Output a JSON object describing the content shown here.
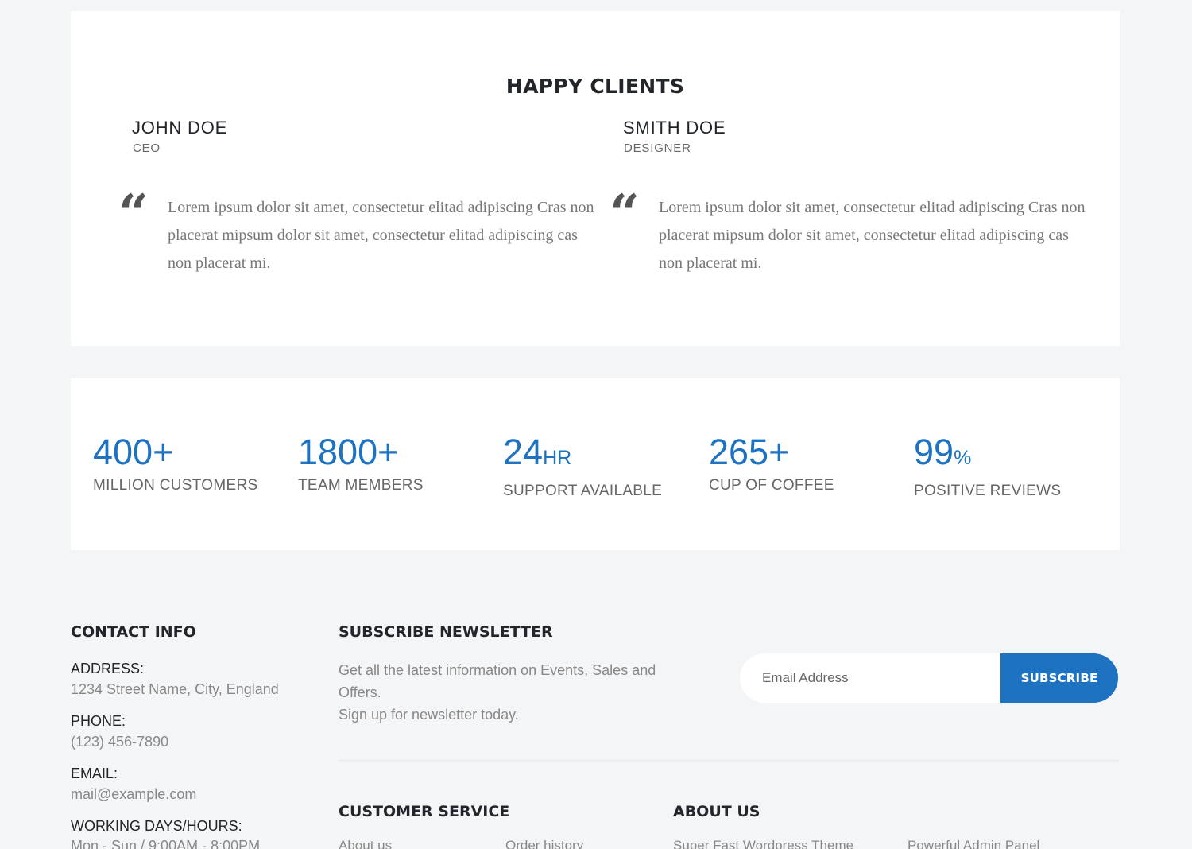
{
  "testimonials": {
    "title": "HAPPY CLIENTS",
    "items": [
      {
        "name": "JOHN DOE",
        "role": "CEO",
        "quote": "Lorem ipsum dolor sit amet, consectetur elitad adipiscing Cras non placerat mipsum dolor sit amet, consectetur elitad adipiscing cas non placerat mi."
      },
      {
        "name": "SMITH DOE",
        "role": "DESIGNER",
        "quote": "Lorem ipsum dolor sit amet, consectetur elitad adipiscing Cras non placerat mipsum dolor sit amet, consectetur elitad adipiscing cas non placerat mi."
      }
    ],
    "quote_glyph": "“"
  },
  "counters": [
    {
      "value": "400",
      "unit": "+",
      "label": "MILLION CUSTOMERS"
    },
    {
      "value": "1800",
      "unit": "+",
      "label": "TEAM MEMBERS"
    },
    {
      "value": "24",
      "unit": "HR",
      "label": "SUPPORT AVAILABLE"
    },
    {
      "value": "265",
      "unit": "+",
      "label": "CUP OF COFFEE"
    },
    {
      "value": "99",
      "unit": "%",
      "label": "POSITIVE REVIEWS"
    }
  ],
  "footer": {
    "contact": {
      "heading": "CONTACT INFO",
      "address_label": "ADDRESS:",
      "address": "1234 Street Name, City, England",
      "phone_label": "PHONE:",
      "phone": "(123) 456-7890",
      "email_label": "EMAIL:",
      "email": "mail@example.com",
      "hours_label": "WORKING DAYS/HOURS:",
      "hours": "Mon - Sun / 9:00AM - 8:00PM"
    },
    "newsletter": {
      "heading": "SUBSCRIBE NEWSLETTER",
      "text_line1": "Get all the latest information on Events, Sales and Offers.",
      "text_line2": "Sign up for newsletter today.",
      "email_placeholder": "Email Address",
      "button_label": "SUBSCRIBE"
    },
    "customer_service": {
      "heading": "CUSTOMER SERVICE",
      "links": [
        "About us",
        "Order history"
      ]
    },
    "about_us": {
      "heading": "ABOUT US",
      "links": [
        "Super Fast Wordpress Theme",
        "Powerful Admin Panel"
      ]
    }
  },
  "colors": {
    "accent": "#1d72c2",
    "background": "#f4f5f7",
    "card": "#ffffff",
    "heading": "#222529",
    "muted": "#888888"
  }
}
